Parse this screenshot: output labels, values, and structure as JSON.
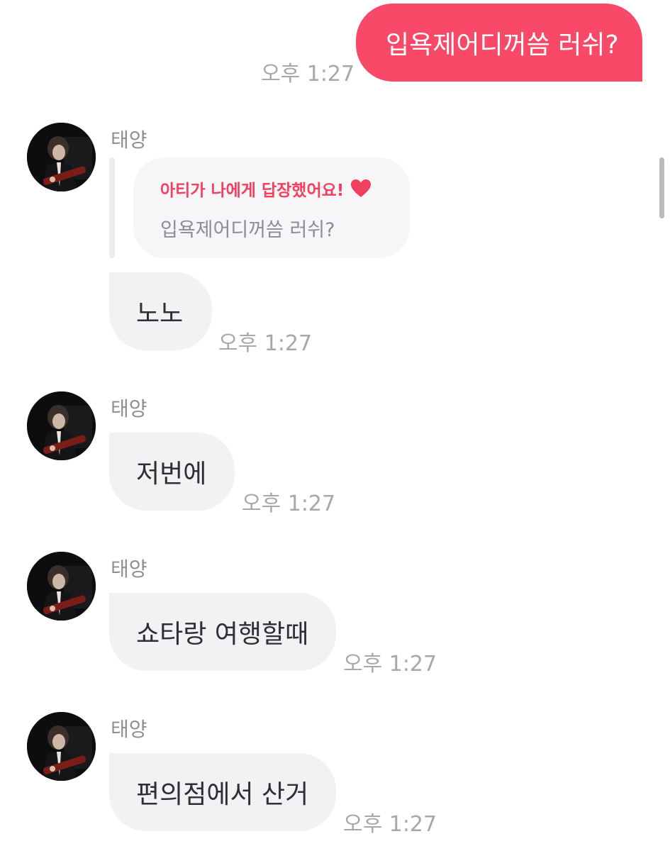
{
  "outgoing": {
    "text": "입욕제어디꺼씀 러쉬?",
    "time": "오후 1:27",
    "color": "#f84a68"
  },
  "messages": [
    {
      "sender": "태양",
      "reply": {
        "title": "아티가 나에게 답장했어요!",
        "quote": "입욕제어디꺼씀 러쉬?"
      },
      "text": "노노",
      "time": "오후 1:27"
    },
    {
      "sender": "태양",
      "text": "저번에",
      "time": "오후 1:27"
    },
    {
      "sender": "태양",
      "text": "쇼타랑 여행할때",
      "time": "오후 1:27"
    },
    {
      "sender": "태양",
      "text": "편의점에서 산거",
      "time": "오후 1:27"
    }
  ],
  "icons": {
    "reply_heart": "heart-icon",
    "avatar": "avatar"
  },
  "colors": {
    "accent": "#f2415f",
    "incoming_bubble": "#f2f2f5",
    "timestamp": "#a7a7ad"
  }
}
